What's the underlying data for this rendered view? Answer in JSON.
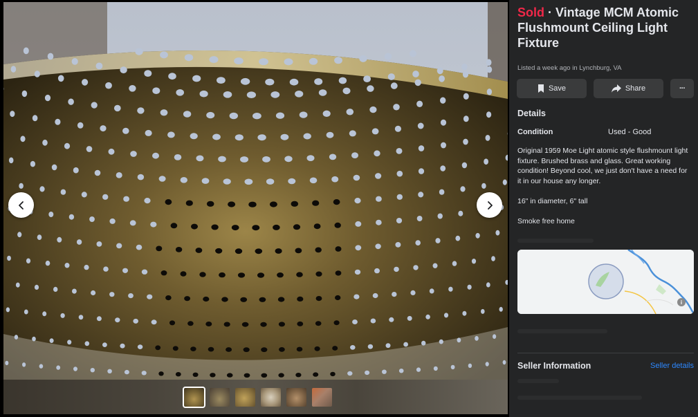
{
  "listing": {
    "status": "Sold",
    "separator": " · ",
    "title": "Vintage MCM Atomic Flushmount Ceiling Light Fixture",
    "listed_text": "Listed a week ago in Lynchburg, VA"
  },
  "actions": {
    "save_label": "Save",
    "share_label": "Share",
    "more_label": "···"
  },
  "details": {
    "heading": "Details",
    "condition_label": "Condition",
    "condition_value": "Used - Good",
    "description": [
      "Original 1959 Moe Light atomic style flushmount light fixture. Brushed brass and glass. Great working condition! Beyond cool, we just don't have a need for it in our house any longer.",
      "16\" in diameter, 6\" tall",
      "Smoke free home"
    ]
  },
  "seller": {
    "heading": "Seller Information",
    "details_link": "Seller details"
  },
  "icons": {
    "prev": "chevron-left-icon",
    "next": "chevron-right-icon",
    "save": "bookmark-icon",
    "share": "share-arrow-icon",
    "more": "ellipsis-icon"
  },
  "colors": {
    "sold": "#f02849",
    "link": "#2d88ff",
    "panel_bg": "#242526",
    "button_bg": "#3a3b3c"
  },
  "photo": {
    "thumbnail_count": 6,
    "active_thumbnail": 1
  }
}
